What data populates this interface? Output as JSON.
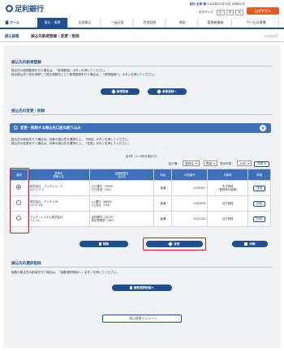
{
  "header": {
    "bank_name": "足利銀行",
    "user_line": "足利 太郎 様",
    "last_login": "20XX年01月23日 09時50分",
    "font_size_label": "文字サイズ",
    "font_sizes": [
      "小",
      "中",
      "大"
    ],
    "logout_label": "ログアウト"
  },
  "nav": {
    "items": [
      "ホーム",
      "振込・振替",
      "全部振込",
      "一括伝送",
      "代金回収",
      "承認",
      "管理者業務",
      "サービス連携"
    ]
  },
  "titlebar": {
    "breadcrumb": "振込振替",
    "title": "振込先新規登録・変更・削除",
    "code": "BFFK002"
  },
  "new_registration": {
    "title": "振込先の新規登録",
    "note1": "振込先の新規登録を行う場合は、「新規登録」ボタンを押してください。",
    "note2": "総合振込先一覧を参照して振込振替先として新規登録を行う場合は、「参照登録へ」ボタンを押してください。",
    "btn_new": "新規登録",
    "btn_ref": "参照登録へ"
  },
  "modify": {
    "title": "振込先の変更・削除",
    "accordion_label": "変更・削除する振込先口座の絞り込み",
    "note1": "振込先の削除を行う場合は、対象の振込先を選択の上、「削除」ボタンを押してください。",
    "note2": "振込先の変更を行う場合は、対象の振込先を選択の上、「変更」ボタンを押してください。",
    "count_text": "全3件（1～3件を表示中）",
    "sort_label": "並び順：",
    "sort_value": "登録名",
    "order_value": "昇順",
    "per_page_label": "表示件数：",
    "per_page_value": "10件",
    "reload_label": "再表示",
    "headers": [
      "選択",
      "登録名\n受取人名",
      "金融機関名\n支店名",
      "科目",
      "口座番号",
      "手数料",
      "詳細"
    ],
    "rows": [
      {
        "reg": "株式会社　アシギンリース",
        "payee": "ｶ)ｱｼｷﾞﾝﾘｰｽ",
        "bank": "〇〇銀行（9996）",
        "branch": "〇〇支店（001）",
        "type": "普通",
        "acct": "1234567",
        "fee": "先方負担\n（登録済み金額）",
        "detail": "詳細",
        "selected": true
      },
      {
        "reg": "株式会社　アシギンDC",
        "payee": "ｶ)ｱｼｷﾞﾝDC",
        "bank": "△△銀行（8888）",
        "branch": "△△支店（234）",
        "type": "普通",
        "acct": "2345678",
        "fee": "当方負担",
        "detail": "詳細",
        "selected": false
      },
      {
        "reg": "アシギンシステム株式会社",
        "payee": "ｱｼｷﾞﾝ(ｶ",
        "bank": "足利銀行（0129）",
        "branch": "本店営業部（100）",
        "type": "普通",
        "acct": "2222222",
        "fee": "当方負担",
        "detail": "詳細",
        "selected": false
      }
    ],
    "btn_delete": "削除",
    "btn_change": "変更",
    "btn_print": "印刷"
  },
  "bulk": {
    "title": "振込先の選択削除",
    "note": "複数の振込先の削除を行う場合は、「複数選択削除へ」ボタンを押してください。",
    "btn": "複数選択削除へ"
  },
  "back_label": "振込振替メニューへ"
}
